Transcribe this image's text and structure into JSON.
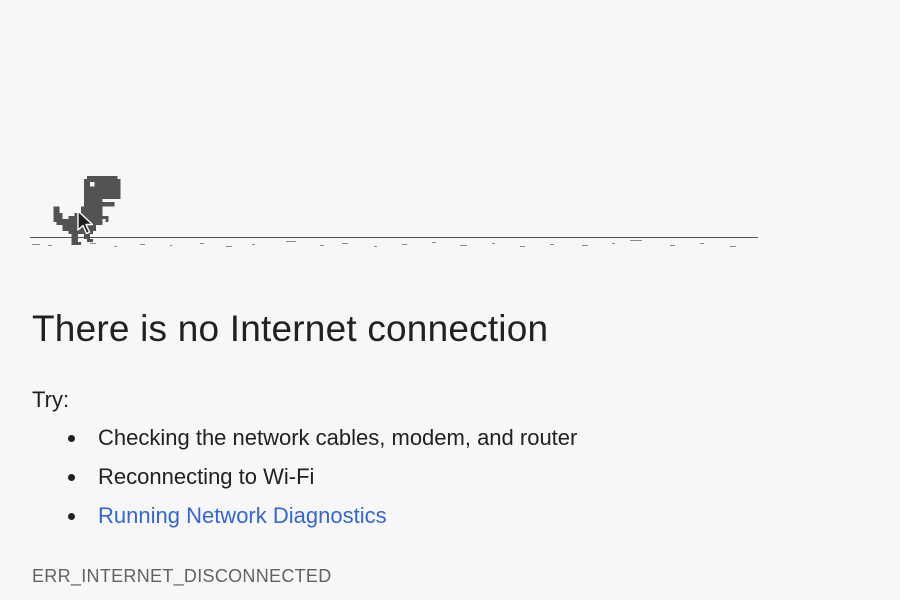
{
  "page": {
    "heading": "There is no Internet connection",
    "try_label": "Try:",
    "suggestions": [
      "Checking the network cables, modem, and router",
      "Reconnecting to Wi-Fi",
      "Running Network Diagnostics"
    ],
    "error_code": "ERR_INTERNET_DISCONNECTED"
  },
  "game": {
    "dino_color": "#535353",
    "ground_color": "#535353"
  },
  "colors": {
    "background": "#f7f7f7",
    "text": "#202124",
    "link": "#3367d6",
    "muted": "#5f6368"
  }
}
